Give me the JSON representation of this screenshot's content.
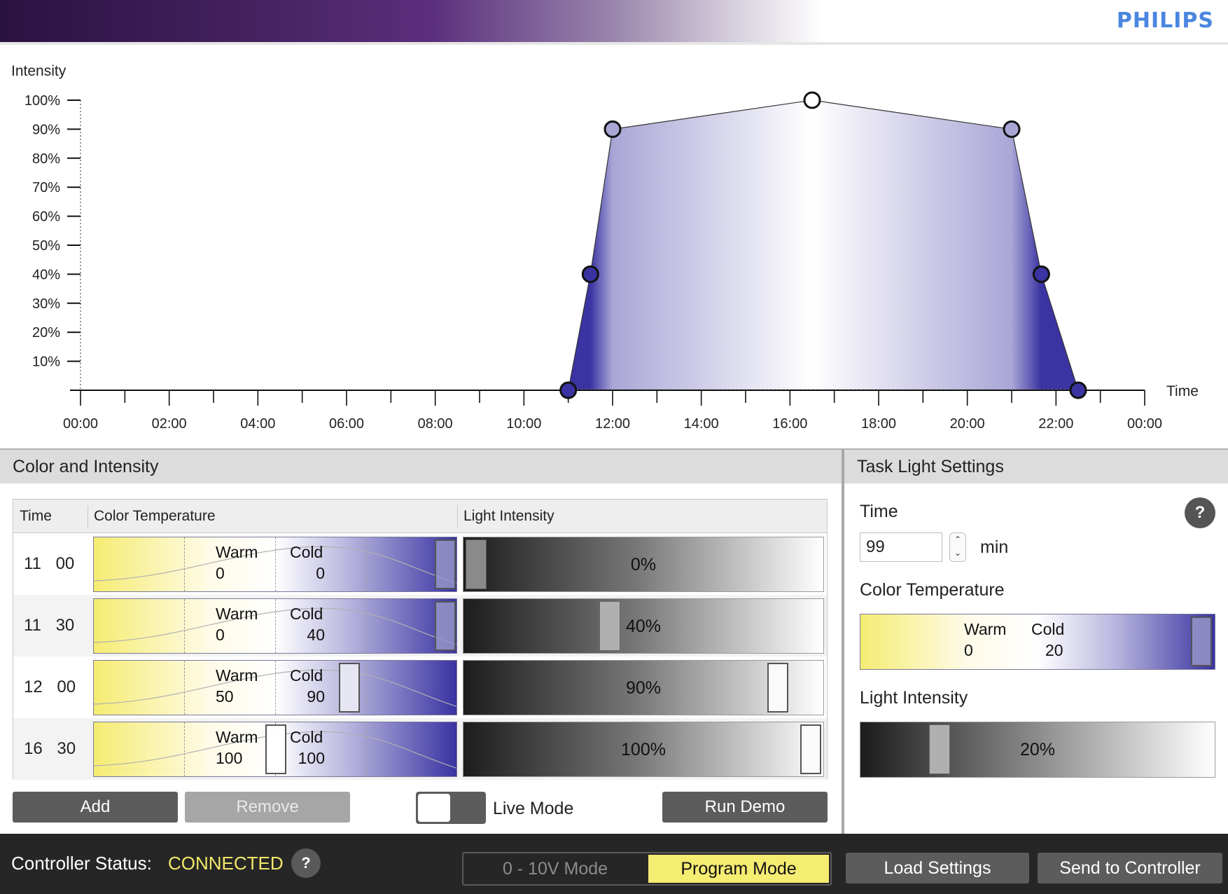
{
  "brand": "PHILIPS",
  "chart_data": {
    "type": "area",
    "ylabel": "Intensity",
    "xlabel": "Time",
    "y_ticks": [
      "10%",
      "20%",
      "30%",
      "40%",
      "50%",
      "60%",
      "70%",
      "80%",
      "90%",
      "100%"
    ],
    "x_ticks": [
      "00:00",
      "02:00",
      "04:00",
      "06:00",
      "08:00",
      "10:00",
      "12:00",
      "14:00",
      "16:00",
      "18:00",
      "20:00",
      "22:00",
      "00:00"
    ],
    "xlim": [
      0,
      24
    ],
    "ylim": [
      0,
      100
    ],
    "points": [
      {
        "time": 11.0,
        "intensity": 0,
        "color": "#3a33a2"
      },
      {
        "time": 11.5,
        "intensity": 40,
        "color": "#3a33a2"
      },
      {
        "time": 12.0,
        "intensity": 90,
        "color": "#a9a6d6"
      },
      {
        "time": 16.5,
        "intensity": 100,
        "color": "#ffffff"
      },
      {
        "time": 21.0,
        "intensity": 90,
        "color": "#a9a6d6"
      },
      {
        "time": 21.67,
        "intensity": 40,
        "color": "#3a33a2"
      },
      {
        "time": 22.5,
        "intensity": 0,
        "color": "#3a33a2"
      }
    ]
  },
  "left_panel": {
    "title": "Color and Intensity",
    "columns": [
      "Time",
      "Color Temperature",
      "Light Intensity"
    ],
    "rows": [
      {
        "time": "11 00",
        "warm_label": "Warm",
        "warm": "0",
        "cold_label": "Cold",
        "cold": "0",
        "intensity_text": "0%",
        "ct_value": 100,
        "intensity": 0
      },
      {
        "time": "11 30",
        "warm_label": "Warm",
        "warm": "0",
        "cold_label": "Cold",
        "cold": "40",
        "intensity_text": "40%",
        "ct_value": 100,
        "intensity": 40
      },
      {
        "time": "12 00",
        "warm_label": "Warm",
        "warm": "50",
        "cold_label": "Cold",
        "cold": "90",
        "intensity_text": "90%",
        "ct_value": 70,
        "intensity": 90
      },
      {
        "time": "16 30",
        "warm_label": "Warm",
        "warm": "100",
        "cold_label": "Cold",
        "cold": "100",
        "intensity_text": "100%",
        "ct_value": 50,
        "intensity": 100
      }
    ],
    "buttons": {
      "add": "Add",
      "remove": "Remove",
      "live_mode": "Live Mode",
      "run_demo": "Run Demo"
    }
  },
  "right_panel": {
    "title": "Task Light Settings",
    "time_label": "Time",
    "time_value": "99",
    "time_unit": "min",
    "help": "?",
    "color_temp_label": "Color Temperature",
    "warm_label": "Warm",
    "warm": "0",
    "cold_label": "Cold",
    "cold": "20",
    "ct_value": 100,
    "light_intensity_label": "Light Intensity",
    "intensity_text": "20%",
    "intensity": 20
  },
  "status_bar": {
    "label": "Controller Status:",
    "value": "CONNECTED",
    "help": "?",
    "mode_10v": "0 - 10V Mode",
    "mode_program": "Program Mode",
    "load": "Load Settings",
    "send": "Send to Controller"
  },
  "colors": {
    "accent_yellow": "#f5ec72",
    "cold_blue": "#3a33a2",
    "brand_blue": "#4a86e0"
  }
}
